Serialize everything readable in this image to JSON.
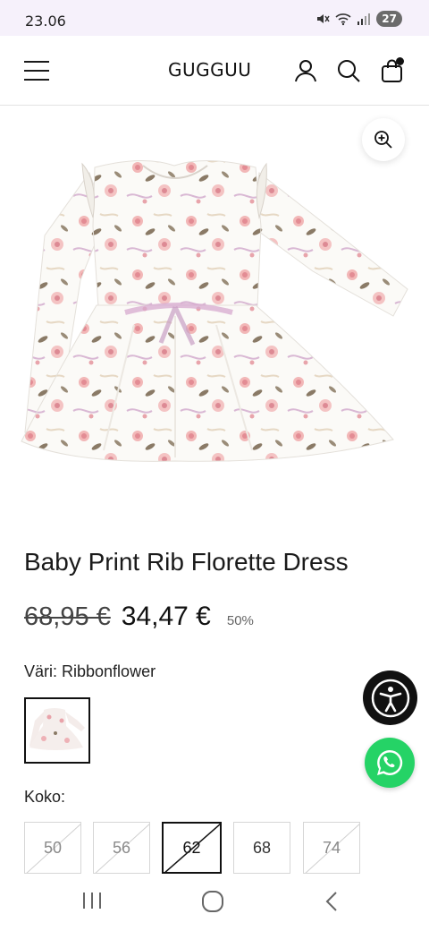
{
  "status_bar": {
    "time": "23.06",
    "battery": "27"
  },
  "header": {
    "logo": "GUGGUU",
    "icons": [
      "menu-icon",
      "account-icon",
      "search-icon",
      "cart-icon"
    ]
  },
  "product": {
    "title": "Baby Print Rib Florette Dress",
    "old_price": "68,95 €",
    "price": "34,47 €",
    "discount": "50%",
    "color_label": "Väri: Ribbonflower",
    "size_label": "Koko:",
    "sizes": [
      {
        "label": "50",
        "state": "unavailable"
      },
      {
        "label": "56",
        "state": "unavailable"
      },
      {
        "label": "62",
        "state": "selected-unavailable"
      },
      {
        "label": "68",
        "state": "available"
      },
      {
        "label": "74",
        "state": "unavailable"
      }
    ]
  },
  "floating": {
    "accessibility": "accessibility-icon",
    "chat": "whatsapp-icon"
  },
  "colors": {
    "accent": "#111111",
    "whatsapp": "#25d366",
    "status_bg": "#f6f1fb"
  }
}
